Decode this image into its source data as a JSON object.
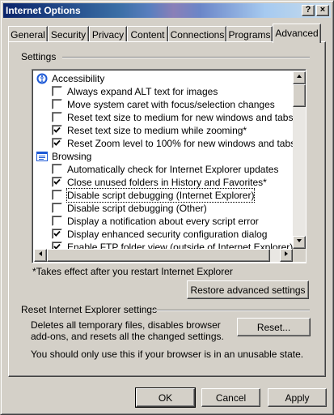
{
  "window": {
    "title": "Internet Options",
    "help_label": "?",
    "close_label": "×"
  },
  "tabs": [
    {
      "label": "General"
    },
    {
      "label": "Security"
    },
    {
      "label": "Privacy"
    },
    {
      "label": "Content"
    },
    {
      "label": "Connections"
    },
    {
      "label": "Programs"
    },
    {
      "label": "Advanced",
      "active": true
    }
  ],
  "settings": {
    "group_label": "Settings",
    "categories": [
      {
        "label": "Accessibility",
        "icon": "accessibility-icon",
        "items": [
          {
            "label": "Always expand ALT text for images",
            "checked": false
          },
          {
            "label": "Move system caret with focus/selection changes",
            "checked": false
          },
          {
            "label": "Reset text size to medium for new windows and tabs",
            "checked": false
          },
          {
            "label": "Reset text size to medium while zooming*",
            "checked": true
          },
          {
            "label": "Reset Zoom level to 100% for new windows and tabs",
            "checked": true
          }
        ]
      },
      {
        "label": "Browsing",
        "icon": "browsing-icon",
        "items": [
          {
            "label": "Automatically check for Internet Explorer updates",
            "checked": false
          },
          {
            "label": "Close unused folders in History and Favorites*",
            "checked": true
          },
          {
            "label": "Disable script debugging (Internet Explorer)",
            "checked": false,
            "focused": true
          },
          {
            "label": "Disable script debugging (Other)",
            "checked": false
          },
          {
            "label": "Display a notification about every script error",
            "checked": false
          },
          {
            "label": "Display enhanced security configuration dialog",
            "checked": true
          },
          {
            "label": "Enable FTP folder view (outside of Internet Explorer)",
            "checked": true
          }
        ]
      }
    ],
    "note": "*Takes effect after you restart Internet Explorer",
    "restore_button": "Restore advanced settings"
  },
  "reset": {
    "group_label": "Reset Internet Explorer settings",
    "description_line1": "Deletes all temporary files, disables browser",
    "description_line2": "add-ons, and resets all the changed settings.",
    "button": "Reset...",
    "warning": "You should only use this if your browser is in an unusable state."
  },
  "footer": {
    "ok": "OK",
    "cancel": "Cancel",
    "apply": "Apply"
  },
  "colors": {
    "title_start": "#0a246a",
    "title_end": "#a6caf0",
    "face": "#d4d0c8"
  }
}
